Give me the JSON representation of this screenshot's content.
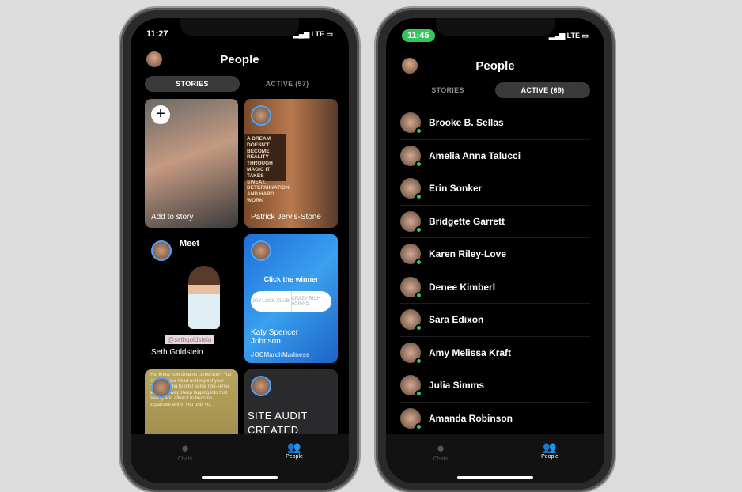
{
  "left": {
    "time": "11:27",
    "carrier": "LTE",
    "title": "People",
    "tabs": [
      "STORIES",
      "ACTIVE (57)"
    ],
    "stories": [
      {
        "label": "Add to story",
        "add": "+"
      },
      {
        "label": "Patrick Jervis-Stone",
        "poster": "A DREAM DOESN'T BECOME REALITY THROUGH MAGIC IT TAKES SWEAT, DETERMINATION AND HARD WORK"
      },
      {
        "label": "Seth Goldstein",
        "heading": "Meet",
        "tag": "@sethgoldstein"
      },
      {
        "label": "Katy Spencer Johnson",
        "heading": "Click the winner",
        "options": [
          "JOY LUCK CLUB",
          "CRAZY RICH ASIANS"
        ],
        "hashtag": "#OCMarchMadness"
      },
      {
        "label": "",
        "text": "You know how dreams come true? You listen to your heart and expect your mind is going to offer some non-sense along the way. Keep tapping into that feeling and allow it to become expansive within you until yo..."
      },
      {
        "label": "SITE AUDIT CREATED NOW"
      }
    ],
    "nav": [
      "Chats",
      "People"
    ]
  },
  "right": {
    "time": "11:45",
    "carrier": "LTE",
    "title": "People",
    "tabs": [
      "STORIES",
      "ACTIVE (69)"
    ],
    "active": [
      "Brooke B. Sellas",
      "Amelia Anna Talucci",
      "Erin Sonker",
      "Bridgette Garrett",
      "Karen Riley-Love",
      "Denee Kimberl",
      "Sara Edixon",
      "Amy Melissa Kraft",
      "Julia Simms",
      "Amanda Robinson"
    ],
    "nav": [
      "Chats",
      "People"
    ]
  }
}
